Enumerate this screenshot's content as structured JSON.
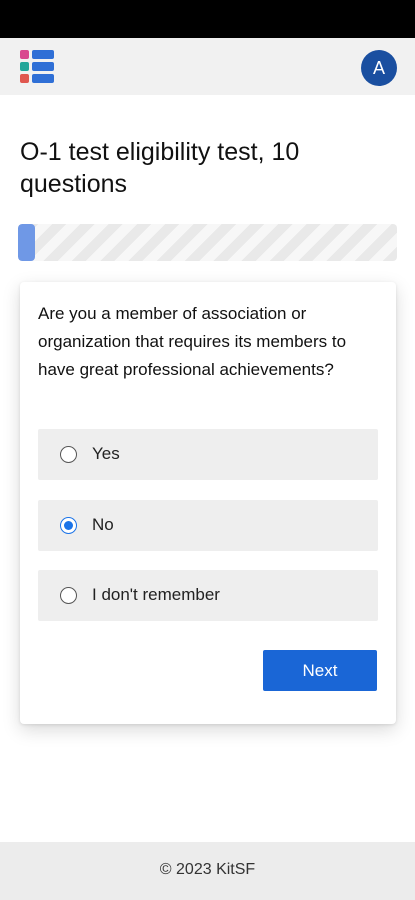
{
  "header": {
    "logo_icon": "kanban-list-icon",
    "logo_colors": [
      "#d9468f",
      "#23a69a",
      "#e0574f"
    ],
    "avatar_initial": "A"
  },
  "page_title": "O-1 test eligibility test, 10 questions",
  "progress": {
    "fraction": 0.045,
    "accent": "#6f98e6"
  },
  "quiz": {
    "question": "Are you a member of association or organization that requires its members to have great professional achievements?",
    "options": [
      {
        "label": "Yes",
        "checked": false
      },
      {
        "label": "No",
        "checked": true
      },
      {
        "label": "I don't remember",
        "checked": false
      }
    ],
    "next_label": "Next"
  },
  "footer": {
    "copyright": "© 2023 KitSF"
  },
  "colors": {
    "primary": "#1a66d6",
    "avatar": "#1a4fa0"
  }
}
